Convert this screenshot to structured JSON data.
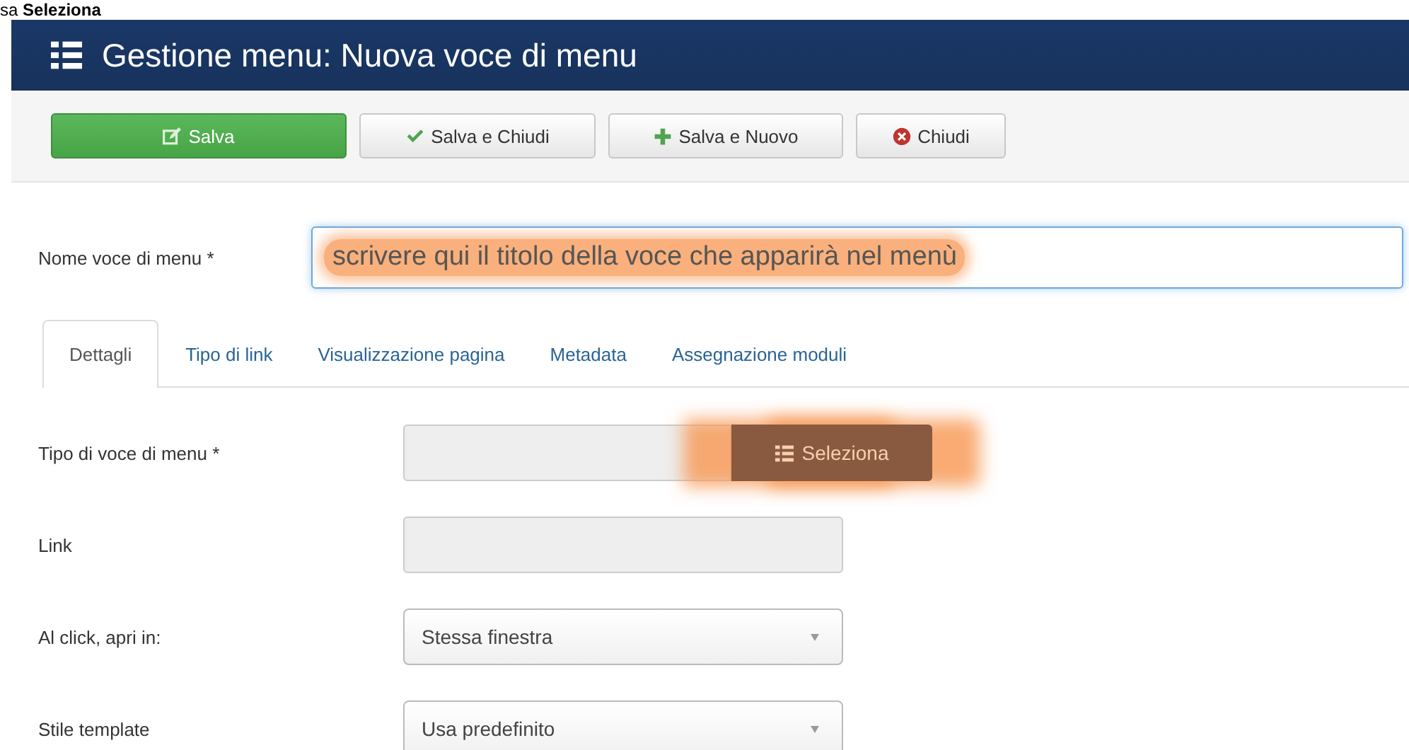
{
  "caption": "sa **Seleziona**",
  "header": {
    "title": "Gestione menu: Nuova voce di menu"
  },
  "toolbar": [
    {
      "kind": "save",
      "label": "Salva"
    },
    {
      "kind": "check",
      "label": "Salva e Chiudi"
    },
    {
      "kind": "plus",
      "label": "Salva e Nuovo"
    },
    {
      "kind": "close",
      "label": "Chiudi"
    }
  ],
  "name_field": {
    "label": "Nome voce di menu *",
    "value": "scrivere qui il titolo della voce che apparirà nel menù",
    "highlighted": true
  },
  "tabs": [
    {
      "label": "Dettagli",
      "selected": true
    },
    {
      "label": "Tipo di link",
      "selected": false
    },
    {
      "label": "Visualizzazione pagina",
      "selected": false
    },
    {
      "label": "Metadata",
      "selected": false
    },
    {
      "label": "Assegnazione moduli",
      "selected": false
    }
  ],
  "fields": [
    {
      "kind": "picker",
      "label": "Tipo di voce di menu *",
      "button": "Seleziona",
      "highlighted": true
    },
    {
      "kind": "text",
      "label": "Link"
    },
    {
      "kind": "select",
      "label": "Al click, apri in:",
      "value": "Stessa finestra"
    },
    {
      "kind": "select",
      "label": "Stile template",
      "value": "Usa predefinito"
    }
  ]
}
